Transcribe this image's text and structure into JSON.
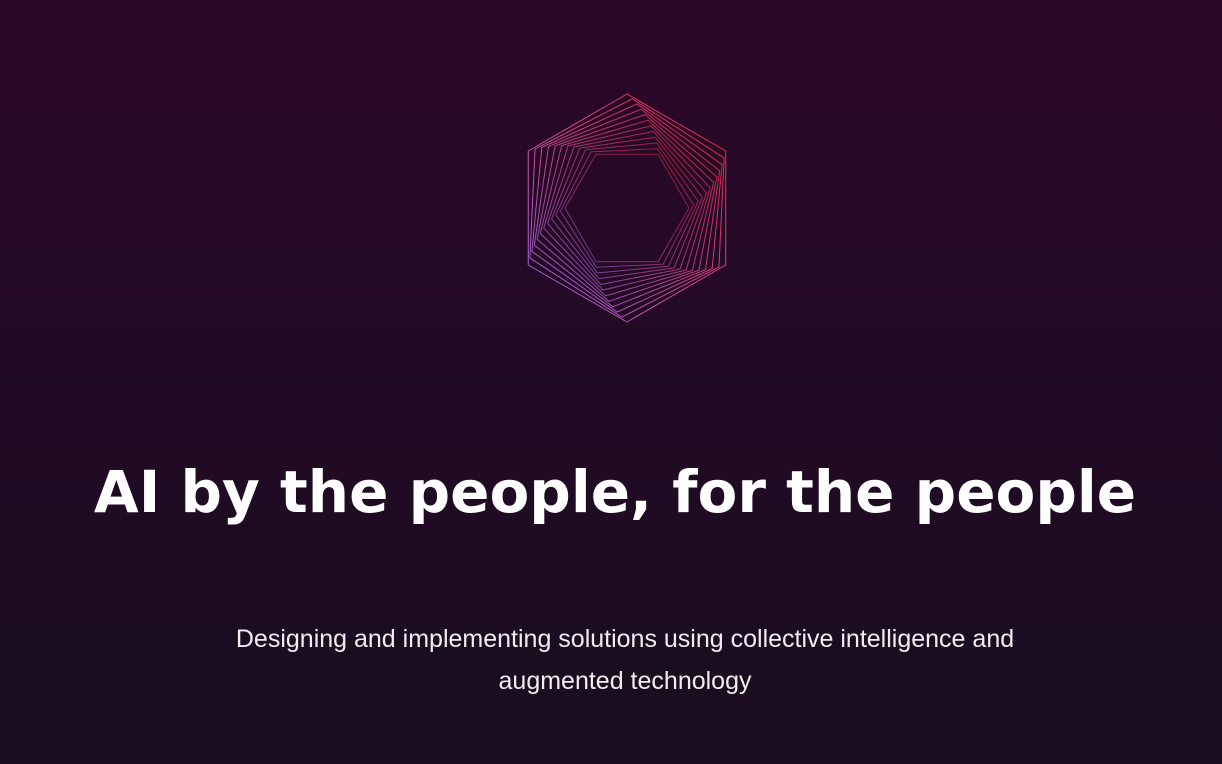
{
  "hero": {
    "logo_icon": "hexagon-spiral-icon",
    "headline": "AI by the people, for the people",
    "subtitle_line1": "Designing and implementing solutions using collective intelligence and",
    "subtitle_line2": "augmented technology"
  },
  "colors": {
    "background_top": "#2c0828",
    "background_bottom": "#1a0d1f",
    "logo_red": "#e8203a",
    "logo_pink": "#d94a8c",
    "logo_purple": "#9a6bf0",
    "text": "#ffffff"
  }
}
